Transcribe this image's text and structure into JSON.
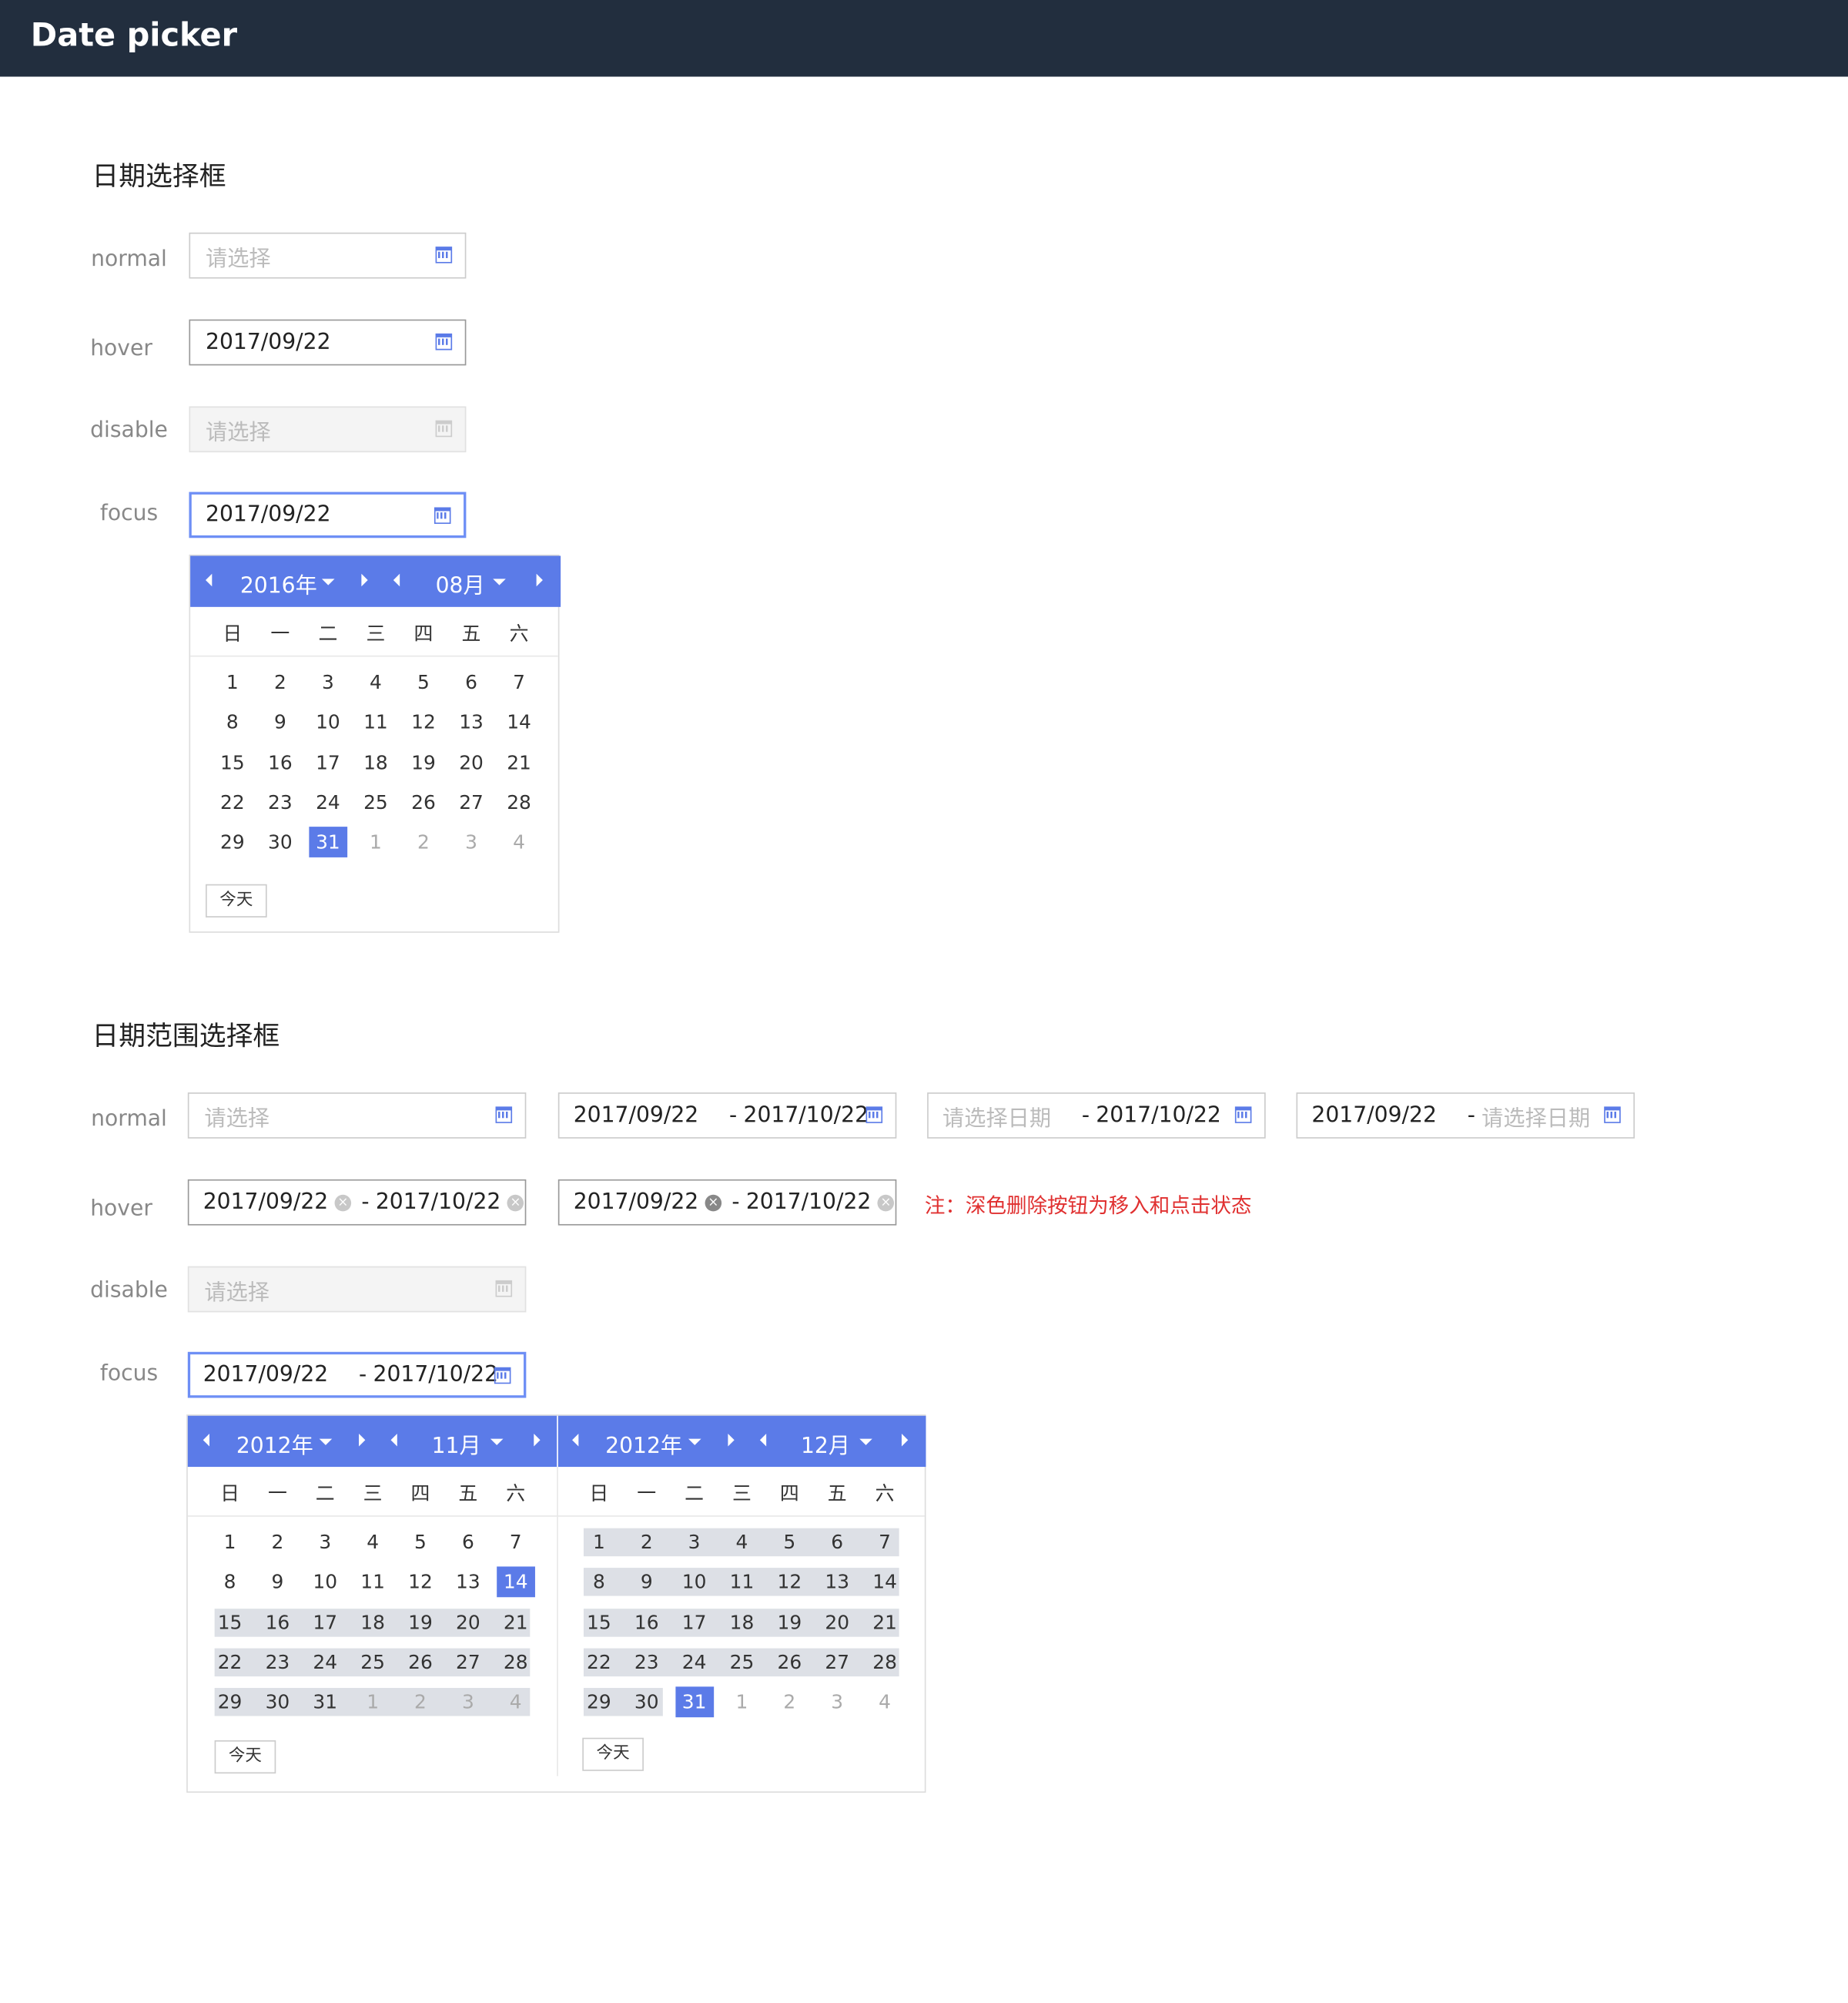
{
  "header": {
    "title": "Date picker"
  },
  "single": {
    "title": "日期选择框",
    "labels": {
      "normal": "normal",
      "hover": "hover",
      "disable": "disable",
      "focus": "focus"
    },
    "placeholder": "请选择",
    "value": "2017/09/22",
    "calendar": {
      "year": "2016年",
      "month": "08月",
      "weekdays": [
        "日",
        "一",
        "二",
        "三",
        "四",
        "五",
        "六"
      ],
      "rows": [
        [
          "1",
          "2",
          "3",
          "4",
          "5",
          "6",
          "7"
        ],
        [
          "8",
          "9",
          "10",
          "11",
          "12",
          "13",
          "14"
        ],
        [
          "15",
          "16",
          "17",
          "18",
          "19",
          "20",
          "21"
        ],
        [
          "22",
          "23",
          "24",
          "25",
          "26",
          "27",
          "28"
        ],
        [
          "29",
          "30",
          "31",
          "1",
          "2",
          "3",
          "4"
        ]
      ],
      "today": "今天"
    }
  },
  "range": {
    "title": "日期范围选择框",
    "labels": {
      "normal": "normal",
      "hover": "hover",
      "disable": "disable",
      "focus": "focus"
    },
    "placeholder": "请选择",
    "start_placeholder": "请选择日期",
    "end_placeholder": "请选择日期",
    "start": "2017/09/22",
    "end": "2017/10/22",
    "sep": "-",
    "clear_glyph": "×",
    "note": "注：深色删除按钮为移入和点击状态",
    "left_cal": {
      "year": "2012年",
      "month": "11月"
    },
    "right_cal": {
      "year": "2012年",
      "month": "12月"
    },
    "weekdays": [
      "日",
      "一",
      "二",
      "三",
      "四",
      "五",
      "六"
    ],
    "rows": [
      [
        "1",
        "2",
        "3",
        "4",
        "5",
        "6",
        "7"
      ],
      [
        "8",
        "9",
        "10",
        "11",
        "12",
        "13",
        "14"
      ],
      [
        "15",
        "16",
        "17",
        "18",
        "19",
        "20",
        "21"
      ],
      [
        "22",
        "23",
        "24",
        "25",
        "26",
        "27",
        "28"
      ],
      [
        "29",
        "30",
        "31",
        "1",
        "2",
        "3",
        "4"
      ]
    ],
    "today": "今天"
  },
  "colors": {
    "header": "#222e3e",
    "accent": "#5b7be8",
    "note": "#e03030"
  }
}
